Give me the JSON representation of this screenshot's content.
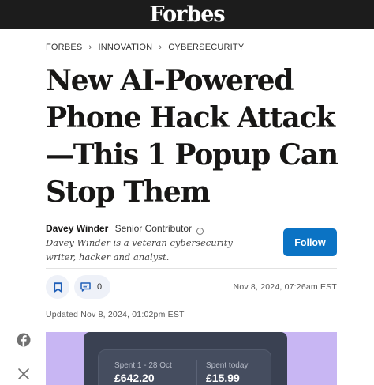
{
  "header": {
    "logo": "Forbes"
  },
  "breadcrumb": [
    "FORBES",
    "INNOVATION",
    "CYBERSECURITY"
  ],
  "article": {
    "title": "New AI-Powered Phone Hack Attack—This 1 Popup Can Stop Them",
    "author_name": "Davey Winder",
    "author_role": "Senior Contributor",
    "author_bio": "Davey Winder is a veteran cybersecurity writer, hacker and analyst.",
    "follow_label": "Follow",
    "comment_count": "0",
    "published": "Nov 8, 2024, 07:26am EST",
    "updated": "Updated Nov 8, 2024, 01:02pm EST"
  },
  "hero_image": {
    "stat1_label": "Spent 1 - 28 Oct",
    "stat1_value": "£642.20",
    "stat2_label": "Spent today",
    "stat2_value": "£15.99"
  },
  "icons": [
    "chevron-right-icon",
    "info-icon",
    "bookmark-icon",
    "comment-icon",
    "facebook-icon",
    "x-icon"
  ],
  "colors": {
    "topbar": "#1c1c1c",
    "follow_button": "#0b73c4",
    "hero_background": "#c8b6f3"
  }
}
